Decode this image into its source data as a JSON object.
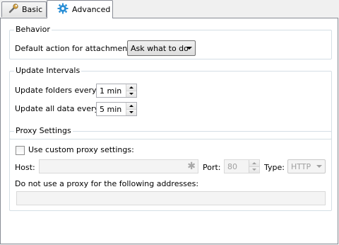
{
  "tabs": {
    "basic": {
      "label": "Basic",
      "icon": "wrench-icon"
    },
    "advanced": {
      "label": "Advanced",
      "icon": "gear-icon"
    }
  },
  "behavior": {
    "title": "Behavior",
    "attachments_label": "Default action for attachments:",
    "attachments_value": "Ask what to do"
  },
  "update_intervals": {
    "title": "Update Intervals",
    "folders_label": "Update folders every:",
    "folders_value": "1 min",
    "all_data_label": "Update all data every:",
    "all_data_value": "5 min"
  },
  "proxy": {
    "title": "Proxy Settings",
    "use_custom_label": "Use custom proxy settings:",
    "use_custom_checked": false,
    "host_label": "Host:",
    "host_value": "",
    "port_label": "Port:",
    "port_value": "80",
    "type_label": "Type:",
    "type_value": "HTTP",
    "bypass_label": "Do not use a proxy for the following addresses:",
    "bypass_value": ""
  },
  "colors": {
    "accent_gear": "#2a8fd6",
    "disabled_text": "#a0a0a0"
  }
}
